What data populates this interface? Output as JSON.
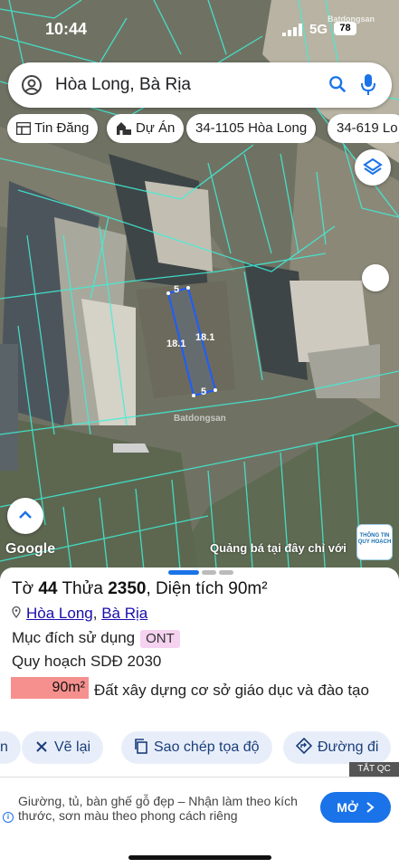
{
  "status": {
    "time": "10:44",
    "network": "5G",
    "battery": "78",
    "watermark": "Batdongsan"
  },
  "search": {
    "query": "Hòa Long, Bà Rịa"
  },
  "chips": [
    {
      "label": "Tin Đăng",
      "icon": "listing-icon"
    },
    {
      "label": "Dự Án",
      "icon": "project-icon"
    },
    {
      "label": "34-1105 Hòa Long",
      "icon": ""
    },
    {
      "label": "34-619 Lo",
      "icon": ""
    }
  ],
  "map": {
    "dims": {
      "top": "5",
      "bottom": "5",
      "left": "18.1",
      "right": "18.1"
    },
    "watermark": "Batdongsan",
    "google": "Google",
    "promo": "Quảng bá tại đây chỉ với",
    "badge": "THÔNG TIN QUY HOẠCH"
  },
  "parcel": {
    "title_prefix": "Tờ",
    "sheet": "44",
    "plot_label": "Thửa",
    "plot": "2350",
    "area_label": ", Diện tích",
    "area": "90m²",
    "ward": "Hòa Long",
    "district": "Bà Rịa",
    "purpose_label": "Mục đích sử dụng",
    "purpose_code": "ONT",
    "plan_label": "Quy hoạch SDĐ 2030",
    "plan_area": "90m²",
    "plan_desc": "Đất xây dựng cơ sở giáo dục và đào tạo"
  },
  "actions": [
    {
      "label": "Vẽ lại",
      "icon": "redraw-icon"
    },
    {
      "label": "Sao chép tọa độ",
      "icon": "copy-icon"
    },
    {
      "label": "Đường đi",
      "icon": "directions-icon"
    }
  ],
  "ad": {
    "tag": "TẮT QC",
    "text": "Giường, tủ, bàn ghế gỗ đẹp – Nhận làm theo kích thước, sơn màu theo phong cách riêng",
    "button": "MỞ"
  }
}
